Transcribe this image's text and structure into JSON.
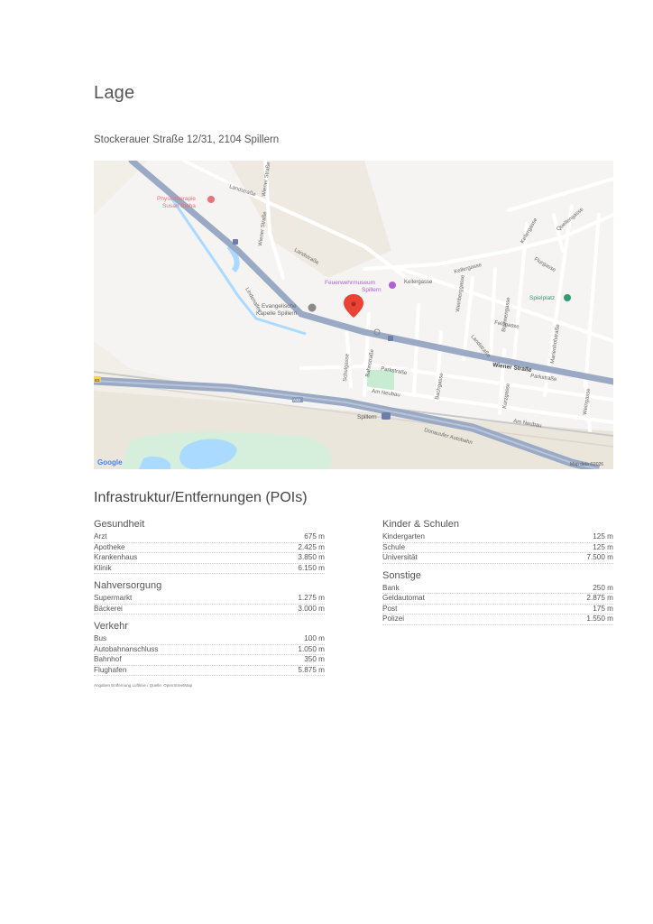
{
  "page": {
    "title": "Lage",
    "address": "Stockerauer Straße 12/31, 2104 Spillern"
  },
  "map": {
    "labels": {
      "physio_line1": "Physiotherapie",
      "physio_line2": "Susan Blaha",
      "landstrasse_top": "Landstraße",
      "wiener_strasse_top": "Wiener Straße",
      "wiener_strasse_mid": "Wiener Straße",
      "landstrasse_mid": "Landstraße",
      "museum_line1": "Feuerwehrmuseum",
      "museum_line2": "Spillern",
      "kellergasse": "Kellergasse",
      "kellergasse2": "Kellergasse",
      "kellergasse_top": "Kellergasse",
      "quellengasse": "Quellengasse",
      "flurgasse": "Flurgasse",
      "spielplatz": "Spielplatz",
      "feldgasse": "Feldgasse",
      "chapel_line1": "Evangelische",
      "chapel_line2": "Kapelle Spillern",
      "lindenallee": "Lindenallee",
      "weinberggasse": "Weinberggasse",
      "brunnengasse": "Brunnengasse",
      "marienhofstrasse": "Marienhofstraße",
      "landstrasse_low": "Landstraße",
      "wiener_strasse_right": "Wiener Straße",
      "schulgasse": "Schulgasse",
      "bahnstrasse": "Bahnstraße",
      "parkstrasse": "Parkstraße",
      "am_neubau": "Am Neubau",
      "bachgasse": "Bachgasse",
      "kurzgasse": "Kurzgasse",
      "parkstrasse_right": "Parkstraße",
      "weingasse": "Weingasse",
      "am_neubau_right": "Am Neubau",
      "spillern_station": "Spillern",
      "a22": "A22",
      "b3": "B3",
      "donauufer": "Donauufer Autobahn",
      "google": "Google",
      "mapdata": "Map data ©2026"
    }
  },
  "poi": {
    "title": "Infrastruktur/Entfernungen (POIs)",
    "left": [
      {
        "title": "Gesundheit",
        "rows": [
          {
            "name": "Arzt",
            "value": "675 m"
          },
          {
            "name": "Apotheke",
            "value": "2.425 m"
          },
          {
            "name": "Krankenhaus",
            "value": "3.850 m"
          },
          {
            "name": "Klinik",
            "value": "6.150 m"
          }
        ]
      },
      {
        "title": "Nahversorgung",
        "rows": [
          {
            "name": "Supermarkt",
            "value": "1.275 m"
          },
          {
            "name": "Bäckerei",
            "value": "3.000 m"
          }
        ]
      },
      {
        "title": "Verkehr",
        "rows": [
          {
            "name": "Bus",
            "value": "100 m"
          },
          {
            "name": "Autobahnanschluss",
            "value": "1.050 m"
          },
          {
            "name": "Bahnhof",
            "value": "350 m"
          },
          {
            "name": "Flughafen",
            "value": "5.875 m"
          }
        ]
      }
    ],
    "right": [
      {
        "title": "Kinder & Schulen",
        "rows": [
          {
            "name": "Kindergarten",
            "value": "125 m"
          },
          {
            "name": "Schule",
            "value": "125 m"
          },
          {
            "name": "Universität",
            "value": "7.500 m"
          }
        ]
      },
      {
        "title": "Sonstige",
        "rows": [
          {
            "name": "Bank",
            "value": "250 m"
          },
          {
            "name": "Geldautomat",
            "value": "2.875 m"
          },
          {
            "name": "Post",
            "value": "175 m"
          },
          {
            "name": "Polizei",
            "value": "1.550 m"
          }
        ]
      }
    ],
    "footnote": "Angaben Entfernung Luftlinie / Quelle: OpenStreetMap"
  },
  "colors": {
    "map_background": "#f2efe9",
    "main_road": "#9aa9c4",
    "water": "#aadaff",
    "park": "#c8ecd2",
    "marker": "#ea4335",
    "poi_pink": "#e8737c",
    "poi_purple": "#b05ed3",
    "poi_green": "#2e9e6c"
  }
}
